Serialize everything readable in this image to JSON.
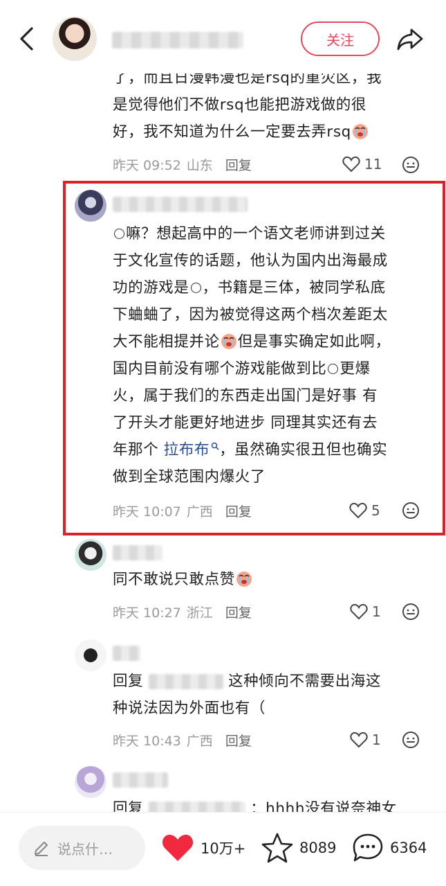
{
  "header": {
    "follow_label": "关注"
  },
  "comments": [
    {
      "id": "c0",
      "lines": [
        "了，而且日漫韩漫也是rsq的重灾区，我",
        "是觉得他们不做rsq也能把游戏做的很",
        "好，我不知道为什么一定要去弄rsq"
      ],
      "time": "昨天 09:52",
      "location": "山东",
      "reply_label": "回复",
      "likes": "11"
    },
    {
      "id": "c1",
      "text_1": "嘛？想起高中的一个语文老师讲到过关",
      "line_2": "于文化宣传的话题，他认为国内出海最成",
      "line_3_a": "功的游戏是",
      "line_3_b": "，书籍是三体，被同学私底",
      "line_4": "下蛐蛐了，因为被觉得这两个档次差距太",
      "line_5_a": "大不能相提并论",
      "line_5_b": "但是事实确定如此啊，",
      "line_6_a": "国内目前没有哪个游戏能做到比",
      "line_6_b": "更爆",
      "line_7": "火，属于我们的东西走出国门是好事  有",
      "line_8": "了开头才能更好地进步  同理其实还有去",
      "line_9_a": "年那个 ",
      "line_9_link": "拉布布",
      "line_9_b": "，虽然确实很丑但也确实",
      "line_10": "做到全球范围内爆火了",
      "time": "昨天 10:07",
      "location": "广西",
      "reply_label": "回复",
      "likes": "5"
    },
    {
      "id": "c2",
      "text": "同不敢说只敢点赞",
      "time": "昨天 10:27",
      "location": "浙江",
      "reply_label": "回复",
      "likes": "1"
    },
    {
      "id": "c3",
      "prefix": "回复",
      "line_1_b": "这种倾向不需要出海这",
      "line_2": "种说法因为外面也有（",
      "time": "昨天 10:43",
      "location": "广西",
      "reply_label": "回复",
      "likes": "1"
    },
    {
      "id": "c4",
      "prefix": "回复",
      "line_1_b": "：hhhh没有说奈神女"
    }
  ],
  "bottom_bar": {
    "input_placeholder": "说点什…",
    "likes": "10万+",
    "stars": "8089",
    "comments": "6364"
  },
  "colors": {
    "accent": "#e8475a",
    "highlight_border": "#d8232a",
    "link": "#2b4d8f"
  },
  "icons": [
    "back-arrow-icon",
    "share-icon",
    "heart-outline-icon",
    "emoji-face-icon",
    "pencil-icon",
    "heart-filled-icon",
    "star-icon",
    "comment-bubble-icon",
    "crying-emoji-icon",
    "search-icon"
  ]
}
